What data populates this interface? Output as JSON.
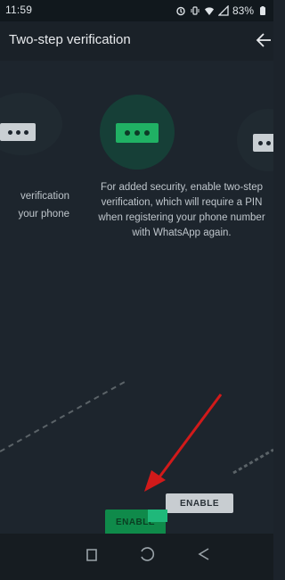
{
  "status_bar": {
    "time": "11:59",
    "battery": "83%",
    "icons": [
      "alarm-icon",
      "vibrate-icon",
      "wifi-icon",
      "signal-icon",
      "battery-icon"
    ]
  },
  "app_bar": {
    "title": "Two-step verification",
    "back_icon": "arrow-left-icon"
  },
  "content": {
    "left_caption_line1": "verification",
    "left_caption_line2": "your phone",
    "center_caption": "For added security, enable two-step verification, which will require a PIN when registering your phone number with WhatsApp again.",
    "pin_dots": 3
  },
  "actions": {
    "enable_label": "ENABLE",
    "enable_ghost_label": "ENABLE"
  },
  "nav_bar": {
    "icons": [
      "recents-icon",
      "home-icon",
      "back-icon"
    ]
  },
  "colors": {
    "accent": "#20b164",
    "annotation_arrow": "#d11a1a",
    "background": "#1d252d"
  }
}
